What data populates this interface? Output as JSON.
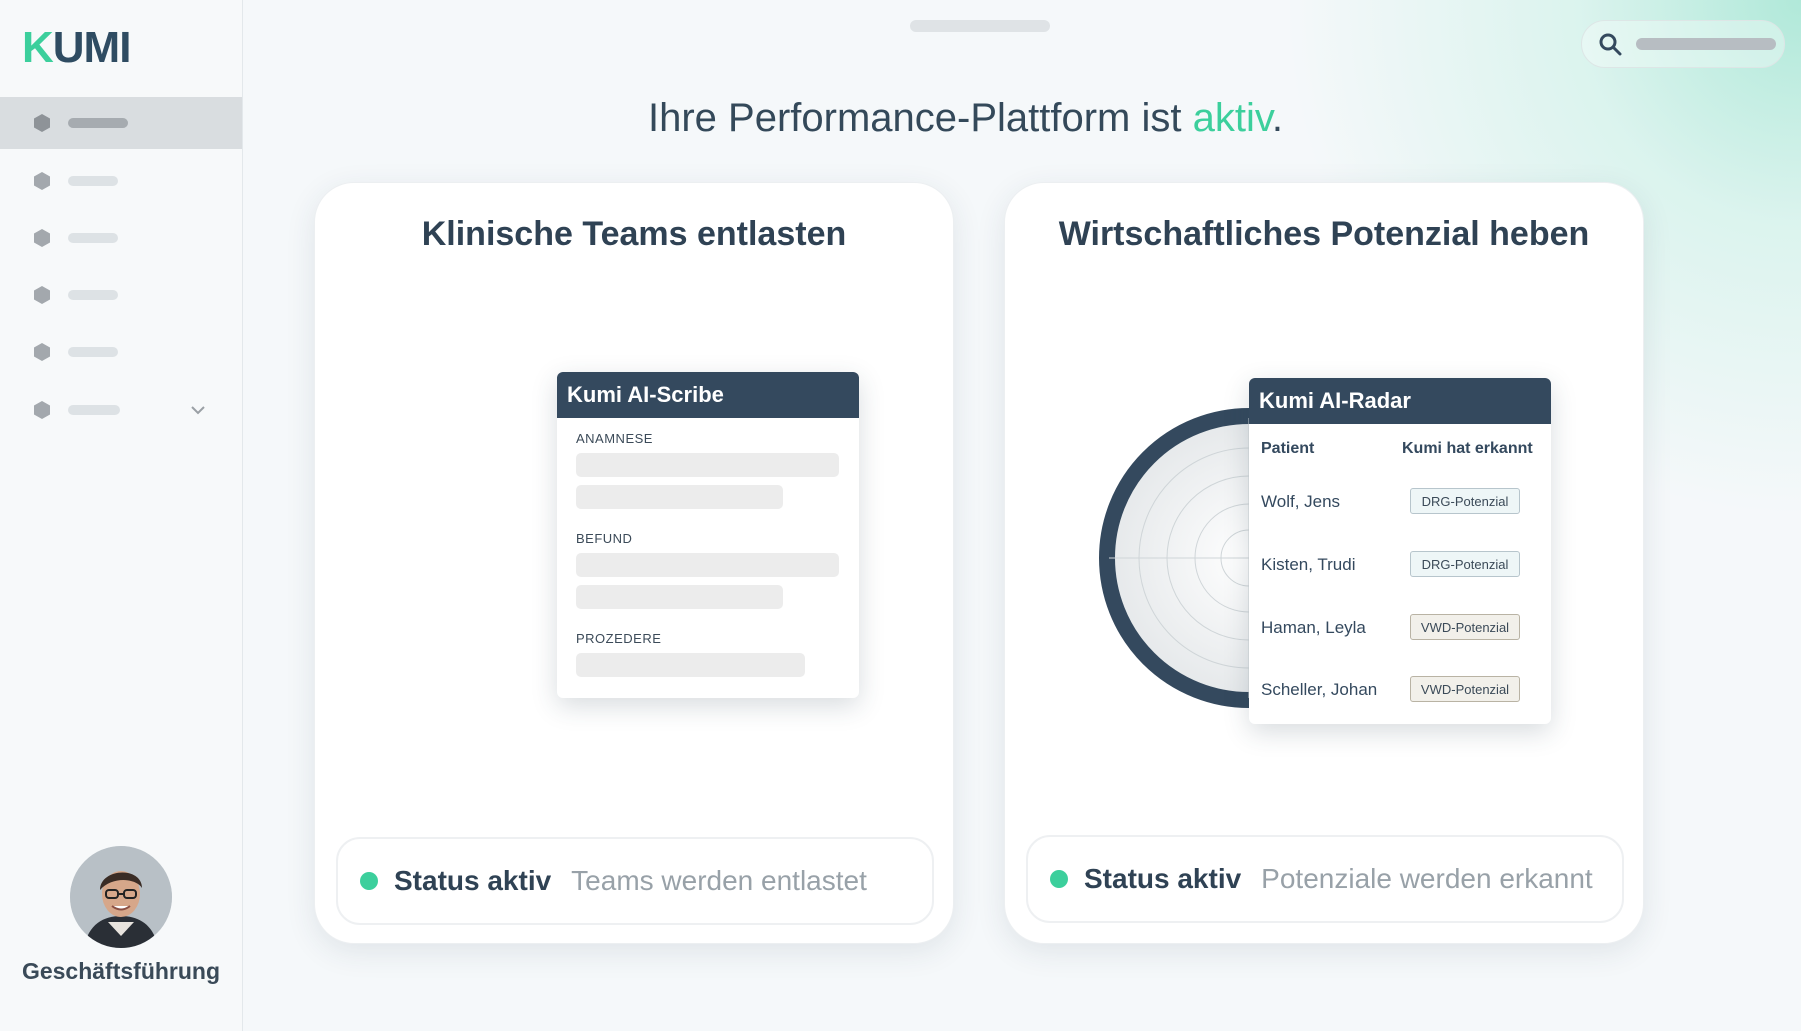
{
  "sidebar": {
    "logo_text": "KUMI",
    "items": [
      {
        "active": true
      },
      {
        "active": false
      },
      {
        "active": false
      },
      {
        "active": false
      },
      {
        "active": false
      },
      {
        "active": false,
        "has_chevron": true
      }
    ],
    "user_role": "Geschäftsführung"
  },
  "header": {
    "headline_main": "Ihre Performance-Plattform ist ",
    "headline_accent": "aktiv",
    "headline_end": ".",
    "search_icon": "search-icon"
  },
  "cards": {
    "clinical": {
      "title": "Klinische Teams entlasten",
      "panel_title": "Kumi AI-Scribe",
      "sections": [
        "ANAMNESE",
        "BEFUND",
        "PROZEDERE"
      ],
      "status_label": "Status aktiv",
      "status_text": "Teams werden entlastet"
    },
    "economic": {
      "title": "Wirtschaftliches Potenzial heben",
      "panel_title": "Kumi AI-Radar",
      "col_patient": "Patient",
      "col_detected": "Kumi hat erkannt",
      "rows": [
        {
          "patient": "Wolf, Jens",
          "tag": "DRG-Potenzial"
        },
        {
          "patient": "Kisten, Trudi",
          "tag": "DRG-Potenzial"
        },
        {
          "patient": "Haman, Leyla",
          "tag": "VWD-Potenzial"
        },
        {
          "patient": "Scheller, Johan",
          "tag": "VWD-Potenzial"
        }
      ],
      "status_label": "Status aktiv",
      "status_text": "Potenziale werden erkannt"
    }
  },
  "colors": {
    "accent": "#3ccf9c",
    "dark": "#34495e"
  }
}
